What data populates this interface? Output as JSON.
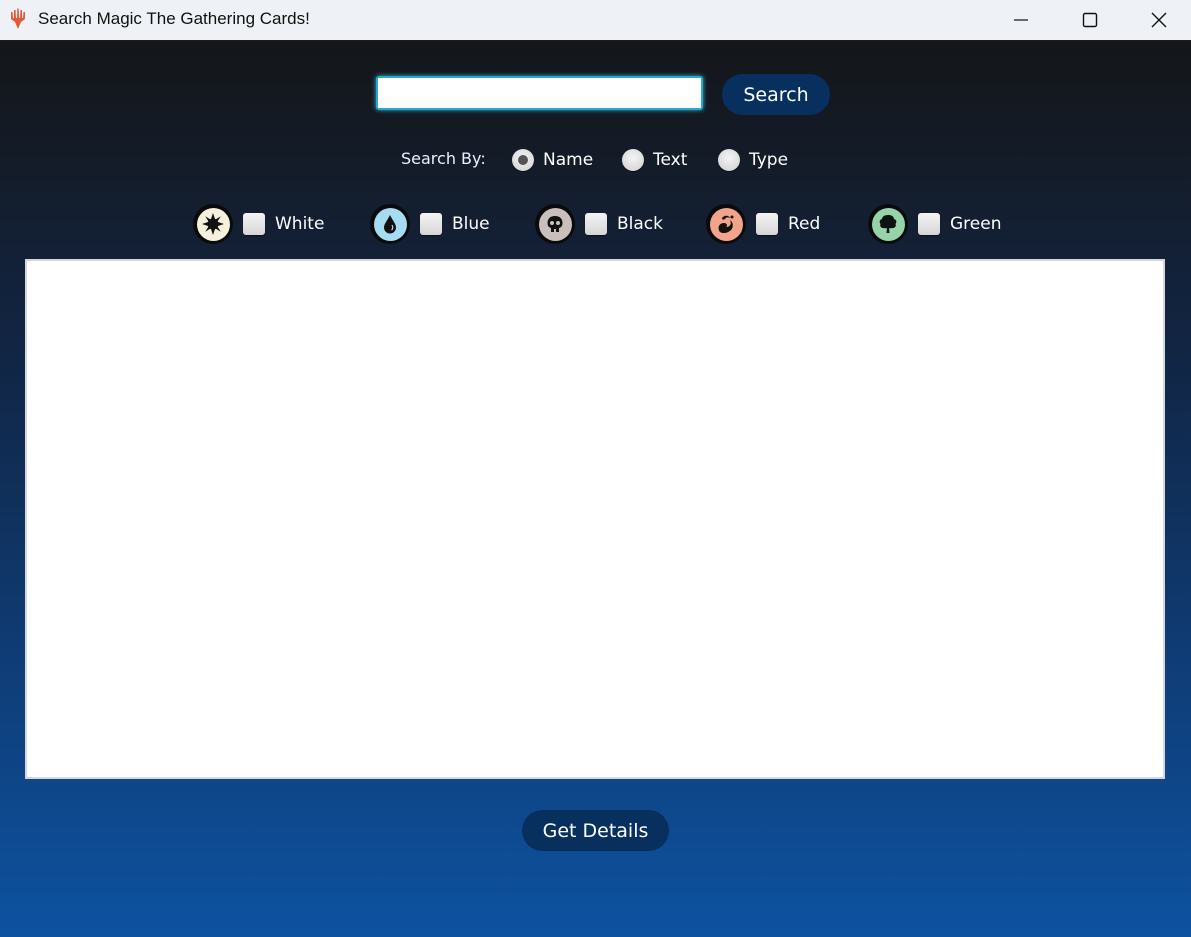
{
  "window": {
    "title": "Search Magic The Gathering Cards!",
    "app_icon": "mtg-hand-icon",
    "controls": {
      "minimize": "minimize-icon",
      "maximize": "maximize-icon",
      "close": "close-icon"
    }
  },
  "search": {
    "value": "",
    "placeholder": "",
    "button_label": "Search"
  },
  "search_by": {
    "label": "Search By:",
    "options": [
      {
        "label": "Name",
        "selected": true
      },
      {
        "label": "Text",
        "selected": false
      },
      {
        "label": "Type",
        "selected": false
      }
    ]
  },
  "colors": [
    {
      "label": "White",
      "icon": "white-mana-sun-icon",
      "checked": false,
      "color": "#f5f1dc"
    },
    {
      "label": "Blue",
      "icon": "blue-mana-drop-icon",
      "checked": false,
      "color": "#a6dcf2"
    },
    {
      "label": "Black",
      "icon": "black-mana-skull-icon",
      "checked": false,
      "color": "#c9c0bd"
    },
    {
      "label": "Red",
      "icon": "red-mana-fire-icon",
      "checked": false,
      "color": "#f2a48a"
    },
    {
      "label": "Green",
      "icon": "green-mana-tree-icon",
      "checked": false,
      "color": "#97d3a9"
    }
  ],
  "results": {
    "items": []
  },
  "details_button_label": "Get Details",
  "theme": {
    "button_bg": "#07305f",
    "input_focus": "#2aa7c9",
    "gradient_top": "#141619",
    "gradient_bottom": "#0d52a0"
  }
}
